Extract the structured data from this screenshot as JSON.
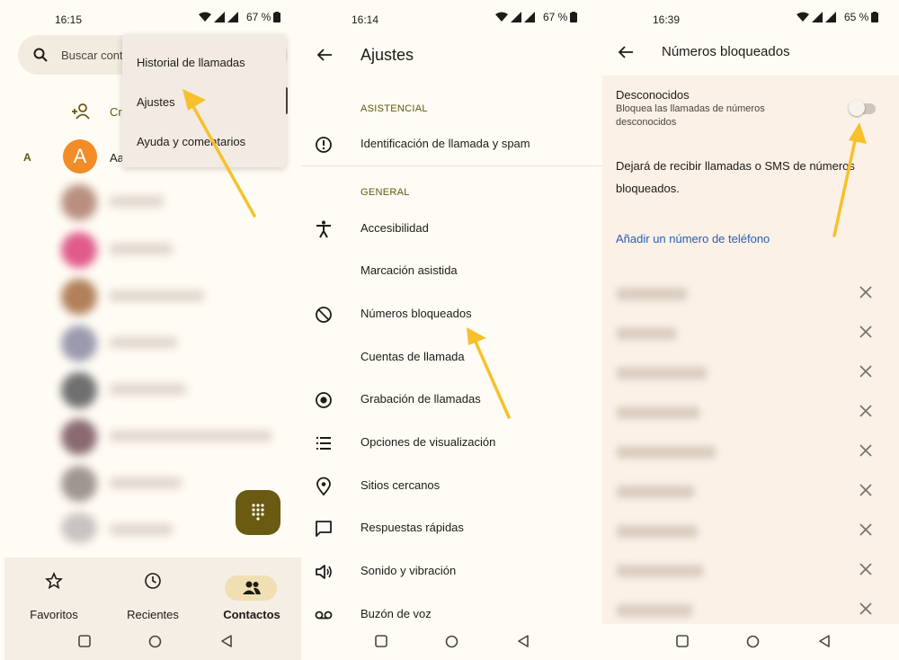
{
  "screen1": {
    "status": {
      "time": "16:15",
      "battery": "67 %"
    },
    "search": {
      "placeholder": "Buscar cont"
    },
    "create_label": "Cre",
    "menu": {
      "items": [
        {
          "label": "Historial de llamadas"
        },
        {
          "label": "Ajustes"
        },
        {
          "label": "Ayuda y comentarios"
        }
      ]
    },
    "contacts": {
      "section_letter": "A",
      "first_avatar": "A",
      "first_name": "Aa"
    },
    "bottom_nav": {
      "items": [
        {
          "label": "Favoritos",
          "icon": "star-icon"
        },
        {
          "label": "Recientes",
          "icon": "clock-icon"
        },
        {
          "label": "Contactos",
          "icon": "people-icon"
        }
      ],
      "active": "Contactos"
    },
    "colors": {
      "accent": "#6b5a12",
      "avatar": "#f28c28",
      "highlight_arrow": "#f6c12b"
    }
  },
  "screen2": {
    "status": {
      "time": "16:14",
      "battery": "67 %"
    },
    "title": "Ajustes",
    "sections": [
      {
        "header": "ASISTENCIAL",
        "items": [
          {
            "label": "Identificación de llamada y spam",
            "icon": "info-alert-icon"
          }
        ]
      },
      {
        "header": "GENERAL",
        "items": [
          {
            "label": "Accesibilidad",
            "icon": "accessibility-icon"
          },
          {
            "label": "Marcación asistida",
            "icon": ""
          },
          {
            "label": "Números bloqueados",
            "icon": "block-icon"
          },
          {
            "label": "Cuentas de llamada",
            "icon": ""
          },
          {
            "label": "Grabación de llamadas",
            "icon": "record-icon"
          },
          {
            "label": "Opciones de visualización",
            "icon": "list-icon"
          },
          {
            "label": "Sitios cercanos",
            "icon": "location-pin-icon"
          },
          {
            "label": "Respuestas rápidas",
            "icon": "message-icon"
          },
          {
            "label": "Sonido y vibración",
            "icon": "speaker-icon"
          },
          {
            "label": "Buzón de voz",
            "icon": "voicemail-icon"
          }
        ]
      }
    ]
  },
  "screen3": {
    "status": {
      "time": "16:39",
      "battery": "65 %"
    },
    "title": "Números bloqueados",
    "unknown": {
      "title": "Desconocidos",
      "subtitle": "Bloquea las llamadas de números desconocidos",
      "enabled": false
    },
    "info": "Dejará de recibir llamadas o SMS de números bloqueados.",
    "add_link": "Añadir un número de teléfono",
    "link_color": "#2a5db0"
  }
}
